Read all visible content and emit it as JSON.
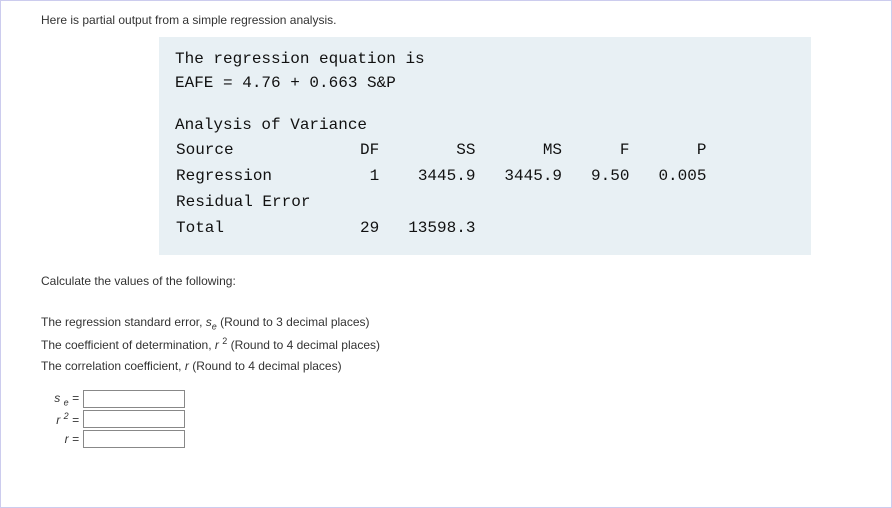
{
  "intro": "Here is partial output from a simple regression analysis.",
  "output": {
    "eq_line1": "The regression equation is",
    "eq_line2": "EAFE = 4.76 + 0.663 S&P",
    "anova_title": "Analysis of Variance",
    "headers": {
      "source": "Source",
      "df": "DF",
      "ss": "SS",
      "ms": "MS",
      "f": "F",
      "p": "P"
    },
    "rows": {
      "regression": {
        "label": "Regression",
        "df": "1",
        "ss": "3445.9",
        "ms": "3445.9",
        "f": "9.50",
        "p": "0.005"
      },
      "resid": {
        "label": "Residual Error",
        "df": "",
        "ss": "",
        "ms": "",
        "f": "",
        "p": ""
      },
      "total": {
        "label": "Total",
        "df": "29",
        "ss": "13598.3",
        "ms": "",
        "f": "",
        "p": ""
      }
    }
  },
  "calc_intro": "Calculate the values of the following:",
  "lines": {
    "l1_a": "The regression standard error, ",
    "l1_b": " (Round to 3 decimal places)",
    "l2_a": "The coefficient of determination, ",
    "l2_b": " (Round to 4 decimal places)",
    "l3_a": "The correlation coefficient, ",
    "l3_b": " (Round to 4 decimal places)"
  },
  "symbols": {
    "se_s": "s",
    "se_e": "e",
    "r": "r",
    "r2_r": "r",
    "r2_2": "2",
    "eq": " = "
  },
  "chart_data": {
    "type": "table",
    "title": "Analysis of Variance",
    "equation": "EAFE = 4.76 + 0.663 S&P",
    "columns": [
      "Source",
      "DF",
      "SS",
      "MS",
      "F",
      "P"
    ],
    "rows": [
      [
        "Regression",
        1,
        3445.9,
        3445.9,
        9.5,
        0.005
      ],
      [
        "Residual Error",
        null,
        null,
        null,
        null,
        null
      ],
      [
        "Total",
        29,
        13598.3,
        null,
        null,
        null
      ]
    ]
  }
}
